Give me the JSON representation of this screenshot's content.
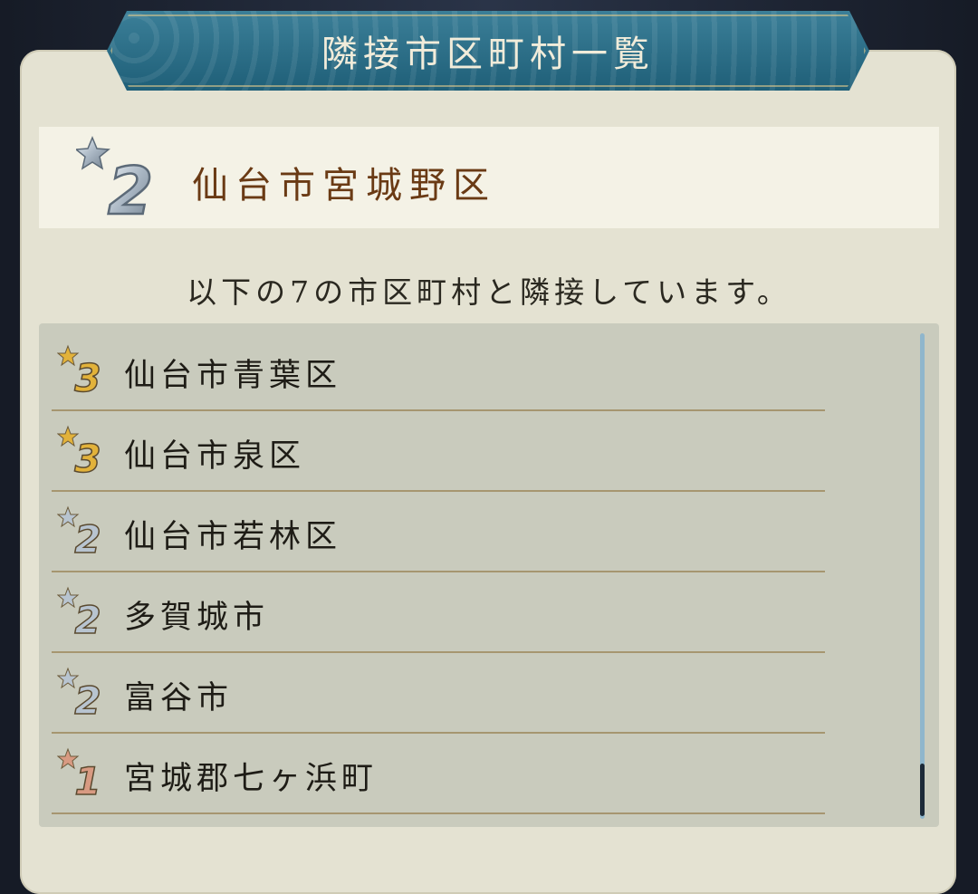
{
  "title": "隣接市区町村一覧",
  "selected": {
    "name": "仙台市宮城野区",
    "rank": "2"
  },
  "subtitle": "以下の7の市区町村と隣接しています。",
  "neighbors": [
    {
      "name": "仙台市青葉区",
      "rank": "3"
    },
    {
      "name": "仙台市泉区",
      "rank": "3"
    },
    {
      "name": "仙台市若林区",
      "rank": "2"
    },
    {
      "name": "多賀城市",
      "rank": "2"
    },
    {
      "name": "富谷市",
      "rank": "2"
    },
    {
      "name": "宮城郡七ヶ浜町",
      "rank": "1"
    }
  ],
  "colors": {
    "gold": "#e2b23a",
    "silver": "#b8c4d0",
    "bronze": "#d89a82"
  }
}
